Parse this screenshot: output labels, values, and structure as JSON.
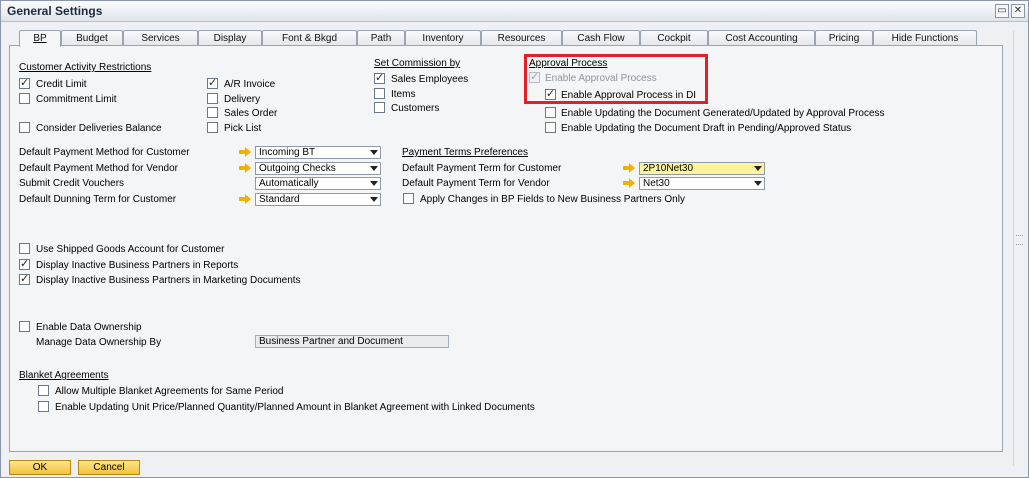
{
  "window": {
    "title": "General Settings",
    "min_icon": "minimize-icon",
    "max_icon": "maximize-icon",
    "close_icon": "close-icon"
  },
  "tabs": [
    "BP",
    "Budget",
    "Services",
    "Display",
    "Font & Bkgd",
    "Path",
    "Inventory",
    "Resources",
    "Cash Flow",
    "Cockpit",
    "Cost Accounting",
    "Pricing",
    "Hide Functions"
  ],
  "active_tab": "BP",
  "customer_activity": {
    "header": "Customer Activity Restrictions",
    "credit_limit": {
      "label": "Credit Limit",
      "checked": true
    },
    "commitment_limit": {
      "label": "Commitment Limit",
      "checked": false
    },
    "consider_deliveries": {
      "label": "Consider Deliveries Balance",
      "checked": false
    },
    "ar_invoice": {
      "label": "A/R Invoice",
      "checked": true
    },
    "delivery": {
      "label": "Delivery",
      "checked": false
    },
    "sales_order": {
      "label": "Sales Order",
      "checked": false
    },
    "pick_list": {
      "label": "Pick List",
      "checked": false
    }
  },
  "commission": {
    "header": "Set Commission by",
    "sales_employees": {
      "label": "Sales Employees",
      "checked": true
    },
    "items": {
      "label": "Items",
      "checked": false
    },
    "customers": {
      "label": "Customers",
      "checked": false
    }
  },
  "approval": {
    "header": "Approval Process",
    "enable": {
      "label": "Enable Approval Process",
      "checked": true
    },
    "enable_di": {
      "label": "Enable Approval Process in DI",
      "checked": true
    },
    "updating_generated": {
      "label": "Enable Updating the Document Generated/Updated by Approval Process",
      "checked": false
    },
    "updating_draft": {
      "label": "Enable Updating the Document Draft in Pending/Approved Status",
      "checked": false
    }
  },
  "payment": {
    "pm_customer": {
      "label": "Default Payment Method for Customer",
      "value": "Incoming BT"
    },
    "pm_vendor": {
      "label": "Default Payment Method for Vendor",
      "value": "Outgoing Checks"
    },
    "credit_vouchers": {
      "label": "Submit Credit Vouchers",
      "value": "Automatically"
    },
    "dunning": {
      "label": "Default Dunning Term for Customer",
      "value": "Standard"
    }
  },
  "payment_terms": {
    "header": "Payment Terms Preferences",
    "customer": {
      "label": "Default Payment Term for Customer",
      "value": "2P10Net30"
    },
    "vendor": {
      "label": "Default Payment Term for Vendor",
      "value": "Net30"
    },
    "apply_changes": {
      "label": "Apply Changes in BP Fields to New Business Partners Only",
      "checked": false
    }
  },
  "misc": {
    "shipped_goods": {
      "label": "Use Shipped Goods Account for Customer",
      "checked": false
    },
    "inactive_reports": {
      "label": "Display Inactive Business Partners in Reports",
      "checked": true
    },
    "inactive_marketing": {
      "label": "Display Inactive Business Partners in Marketing Documents",
      "checked": true
    }
  },
  "ownership": {
    "enable": {
      "label": "Enable Data Ownership",
      "checked": false
    },
    "manage_label": "Manage Data Ownership By",
    "manage_value": "Business Partner and Document"
  },
  "blanket": {
    "header": "Blanket Agreements",
    "multiple": {
      "label": "Allow Multiple Blanket Agreements for Same Period",
      "checked": false
    },
    "updating": {
      "label": "Enable Updating Unit Price/Planned Quantity/Planned Amount in Blanket Agreement with Linked Documents",
      "checked": false
    }
  },
  "buttons": {
    "ok": "OK",
    "cancel": "Cancel"
  },
  "colors": {
    "highlight_box": "#e2202a",
    "link_arrow": "#f2b100",
    "selected_field": "#fdf39b",
    "button": "#f3c33b"
  }
}
